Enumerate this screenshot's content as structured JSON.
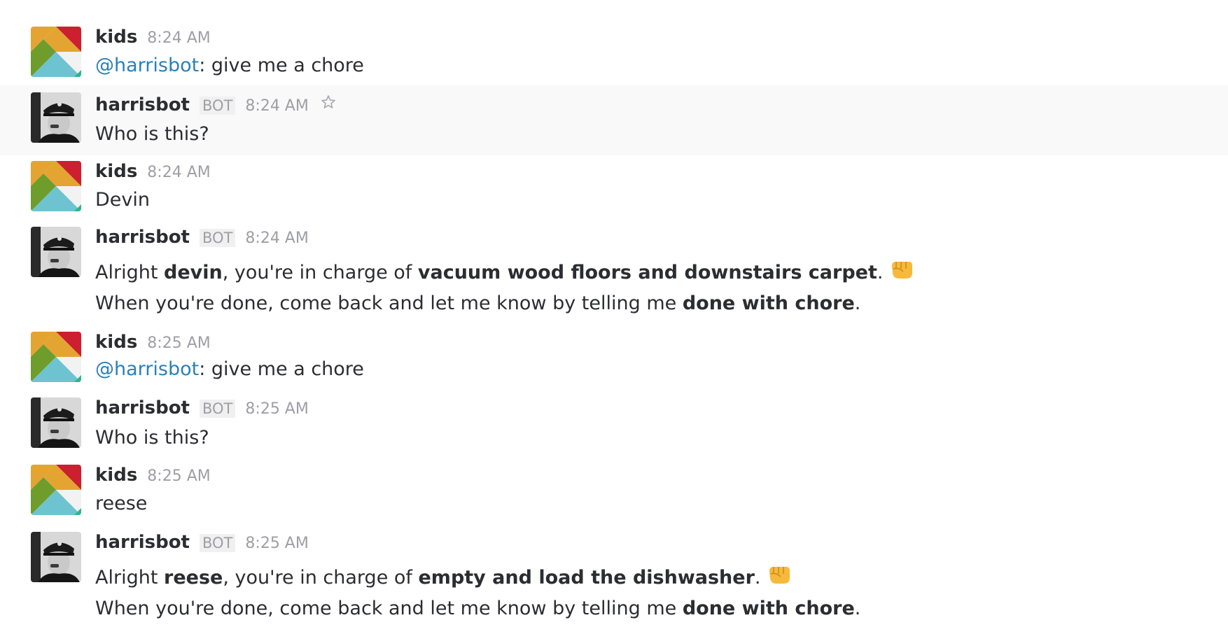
{
  "messages": [
    {
      "user": "kids",
      "time": "8:24 AM",
      "mention": "@harrisbot",
      "text": ": give me a chore"
    },
    {
      "user": "harrisbot",
      "badge": "BOT",
      "time": "8:24 AM",
      "text": "Who is this?"
    },
    {
      "user": "kids",
      "time": "8:24 AM",
      "text": "Devin"
    },
    {
      "user": "harrisbot",
      "badge": "BOT",
      "time": "8:24 AM",
      "p1": "Alright ",
      "b1": "devin",
      "p2": ", you're in charge of ",
      "b2": "vacuum wood floors and downstairs carpet",
      "p3": ".",
      "l2a": "When you're done, come back and let me know by telling me ",
      "l2b": "done with chore",
      "l2c": "."
    },
    {
      "user": "kids",
      "time": "8:25 AM",
      "mention": "@harrisbot",
      "text": ": give me a chore"
    },
    {
      "user": "harrisbot",
      "badge": "BOT",
      "time": "8:25 AM",
      "text": "Who is this?"
    },
    {
      "user": "kids",
      "time": "8:25 AM",
      "text": "reese"
    },
    {
      "user": "harrisbot",
      "badge": "BOT",
      "time": "8:25 AM",
      "p1": "Alright ",
      "b1": "reese",
      "p2": ", you're in charge of ",
      "b2": "empty and load the dishwasher",
      "p3": ".",
      "l2a": "When you're done, come back and let me know by telling me ",
      "l2b": "done with chore",
      "l2c": "."
    }
  ],
  "icons": {
    "star": "star-outline-icon",
    "fist": "oncoming-fist-emoji"
  },
  "colors": {
    "mention": "#2a80b9",
    "hover_bg": "#f9f9f9",
    "meta": "#9e9ea6"
  }
}
